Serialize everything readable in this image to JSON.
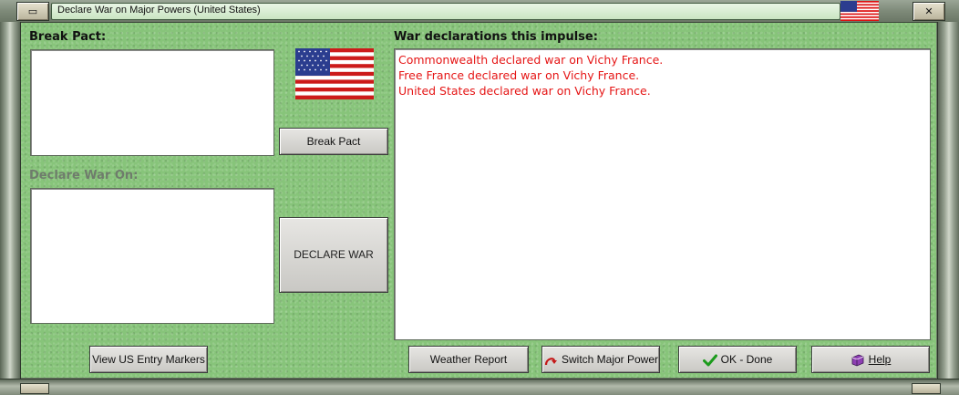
{
  "window": {
    "title": "Declare War on Major Powers (United States)",
    "min_glyph": "▭",
    "close_glyph": "✕"
  },
  "left": {
    "break_pact_label": "Break Pact:",
    "declare_war_on_label": "Declare War On:",
    "break_pact_items": [],
    "declare_war_items": []
  },
  "center": {
    "flag_icon": "us-flag-icon",
    "break_pact_button": "Break Pact",
    "declare_war_button": "DECLARE WAR"
  },
  "right": {
    "declarations_label": "War declarations this impulse:",
    "declarations": [
      "Commonwealth declared war on Vichy France.",
      "Free France declared war on Vichy France.",
      "United States declared war on Vichy France."
    ]
  },
  "footer": {
    "view_us_entry": "View US Entry Markers",
    "weather_report": "Weather Report",
    "switch_major_power": "Switch Major Power",
    "ok_done": "OK - Done",
    "help": "Help"
  },
  "colors": {
    "background_green": "#87c47a",
    "declaration_text": "#e51515",
    "disabled_label": "#6f7c6c"
  },
  "icons": {
    "switch": "switch-arrow-icon",
    "ok": "checkmark-icon",
    "help": "help-book-icon"
  }
}
